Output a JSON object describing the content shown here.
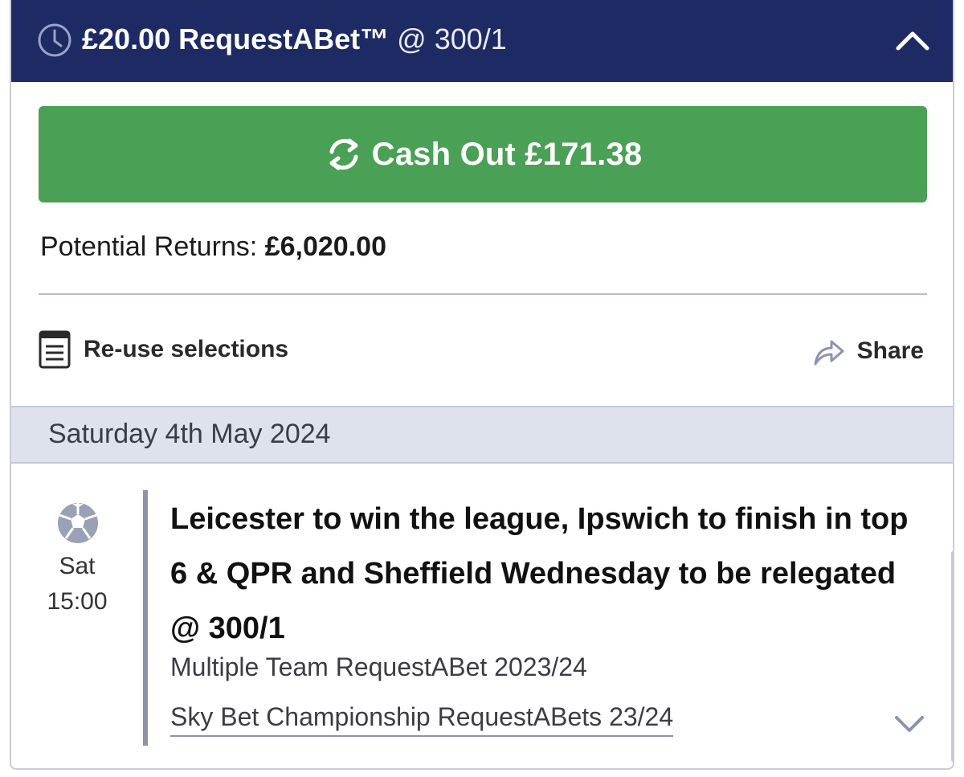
{
  "header": {
    "stake": "£20.00 RequestABet™",
    "odds": "@ 300/1",
    "clock_icon": "clock-icon",
    "collapse_icon": "chevron-up-icon",
    "background_color": "#1e2a63"
  },
  "cashout": {
    "label": "Cash Out £171.38",
    "icon": "refresh-icon",
    "color": "#4aa054"
  },
  "returns": {
    "label": "Potential Returns:",
    "amount": "£6,020.00"
  },
  "actions": {
    "reuse_label": "Re-use selections",
    "reuse_icon": "list-icon",
    "share_label": "Share",
    "share_icon": "share-arrow-icon"
  },
  "date": {
    "label": "Saturday 4th May 2024"
  },
  "selection": {
    "sport_icon": "football-icon",
    "day": "Sat",
    "time": "15:00",
    "title": "Leicester to win the league, Ipswich to finish in top 6 & QPR and Sheffield Wednesday to be relegated @ 300/1",
    "market": "Multiple Team RequestABet 2023/24",
    "event": "Sky Bet Championship RequestABets 23/24",
    "expand_icon": "chevron-down-icon"
  }
}
